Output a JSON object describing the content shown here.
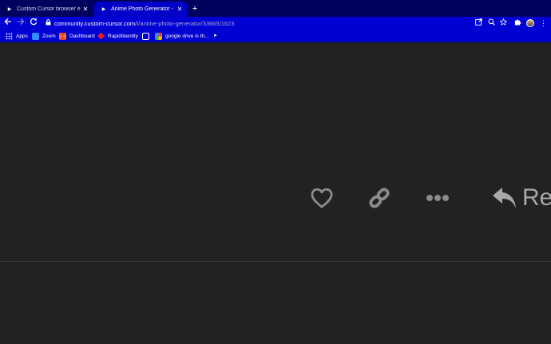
{
  "tabs": [
    {
      "title": "Custom Cursor browser extension",
      "favicon": "play-icon",
      "active": false
    },
    {
      "title": "Anime Photo Generator - General",
      "favicon": "play-icon",
      "active": true
    }
  ],
  "new_tab_glyph": "+",
  "address": {
    "host": "community.custom-cursor.com",
    "path": "/t/anime-photo-generator/33665/1623"
  },
  "toolbar_icons": [
    "back-icon",
    "forward-icon",
    "reload-icon",
    "lock-icon",
    "open-in-app-icon",
    "zoom-icon",
    "star-icon",
    "extensions-icon",
    "profile-avatar",
    "menu-icon"
  ],
  "bookmarks": [
    {
      "label": "Apps",
      "icon": "apps-grid-icon"
    },
    {
      "label": "Zoom",
      "icon": "zoom-logo-icon"
    },
    {
      "label": "Dashboard",
      "icon": "dashboard-icon"
    },
    {
      "label": "RapidIdentity",
      "icon": "rapididentity-icon"
    },
    {
      "label": "",
      "icon": "tablet-icon"
    },
    {
      "label": "google drive is th...",
      "icon": "google-icon"
    }
  ],
  "post_actions": {
    "like_icon": "heart-icon",
    "link_icon": "link-icon",
    "more_icon": "more-icon",
    "reply_icon": "reply-arrow-icon",
    "reply_label": "Re"
  },
  "colors": {
    "tabbar": "#00005e",
    "toolbar": "#0000d2",
    "content_bg": "#222222",
    "action_grey": "#8c8c8c"
  }
}
